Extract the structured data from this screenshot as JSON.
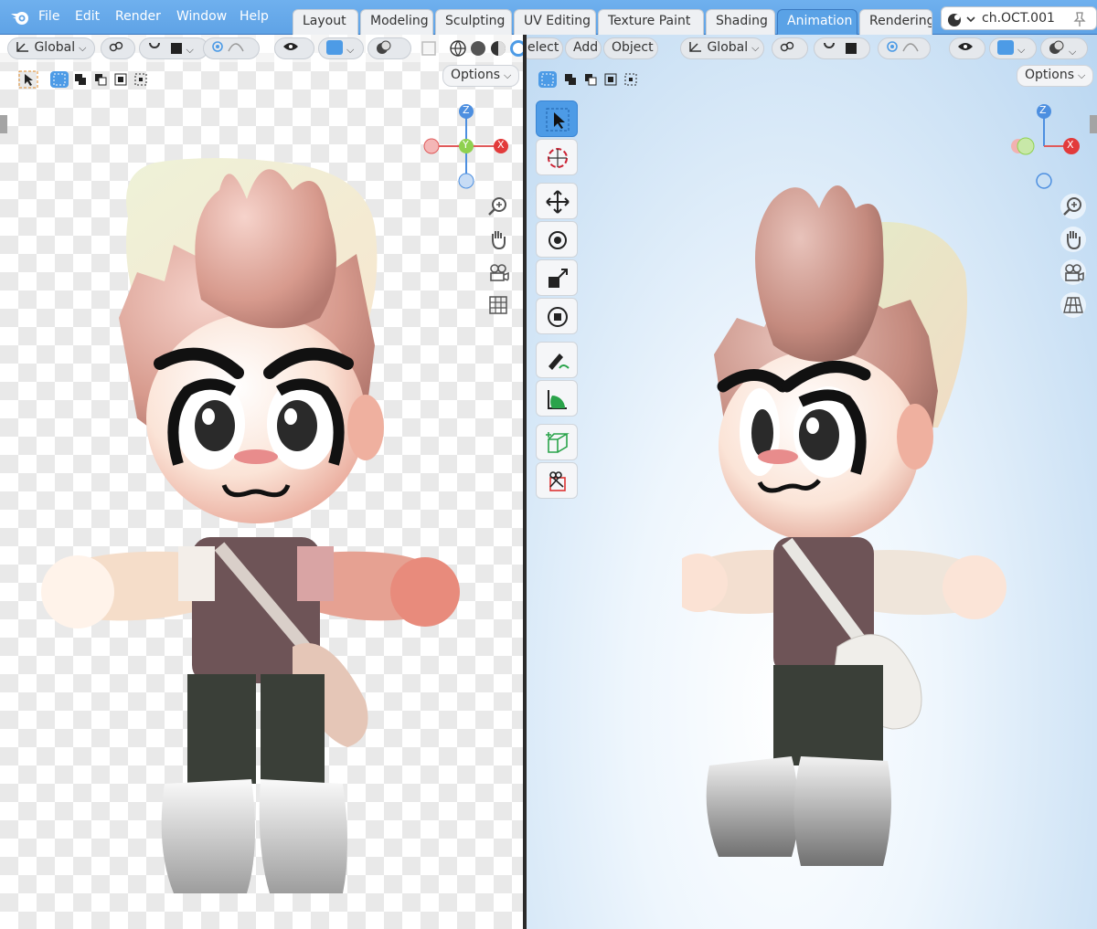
{
  "app": {
    "menu": [
      "File",
      "Edit",
      "Render",
      "Window",
      "Help"
    ],
    "workspace_tabs": [
      {
        "label": "Layout",
        "active": false
      },
      {
        "label": "Modeling",
        "active": false
      },
      {
        "label": "Sculpting",
        "active": false
      },
      {
        "label": "UV Editing",
        "active": false
      },
      {
        "label": "Texture Paint",
        "active": false
      },
      {
        "label": "Shading",
        "active": false
      },
      {
        "label": "Animation",
        "active": true
      },
      {
        "label": "Rendering",
        "active": false
      }
    ],
    "scene_name": "ch.OCT.001",
    "accent_color": "#5aa2e6"
  },
  "left_viewport": {
    "orientation_label": "Global",
    "options_label": "Options",
    "gizmo_axes": {
      "z": "Z",
      "y": "Y",
      "x": "X"
    }
  },
  "right_viewport": {
    "menu": [
      "elect",
      "Add",
      "Object"
    ],
    "orientation_label": "Global",
    "options_label": "Options",
    "gizmo_axes": {
      "z": "Z",
      "y": "Y",
      "x": "X"
    },
    "toolbar": [
      "select-box-icon",
      "cursor-icon",
      "move-icon",
      "rotate-icon",
      "scale-icon",
      "transform-icon",
      "annotate-icon",
      "measure-icon",
      "add-cube-icon",
      "knife-icon"
    ]
  },
  "character_colors": {
    "hair": "#d99c8f",
    "skin": "#fbe4d7",
    "shirt": "#6e5457",
    "pants": "#3a3f38",
    "shoes": "#dcdcdc",
    "bag": "#eeeeee"
  }
}
